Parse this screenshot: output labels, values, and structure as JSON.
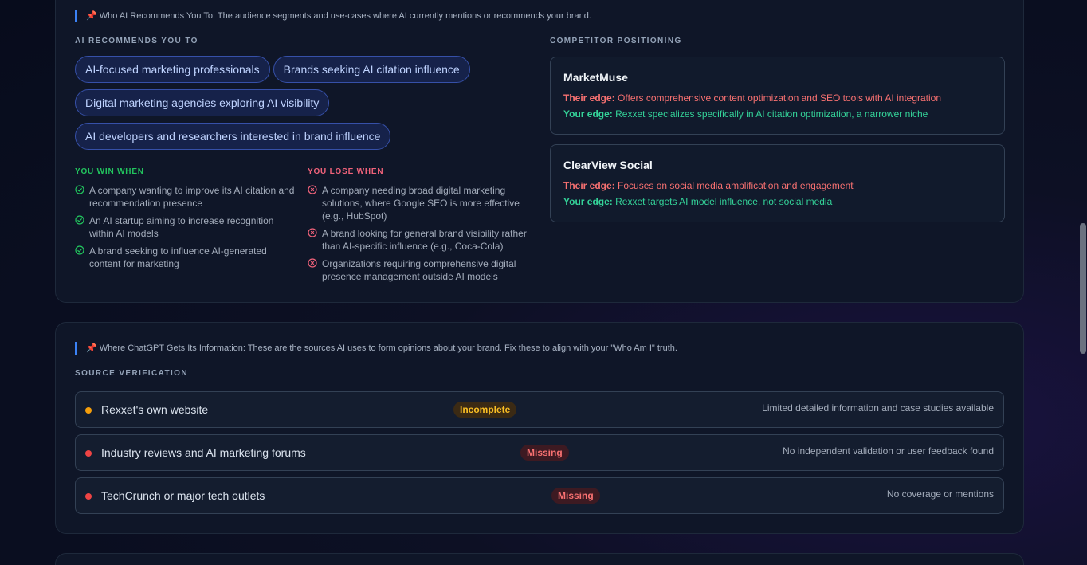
{
  "recommend_section": {
    "note": "📌 Who AI Recommends You To: The audience segments and use-cases where AI currently mentions or recommends your brand.",
    "title": "AI RECOMMENDS YOU TO",
    "chips": [
      "AI-focused marketing professionals",
      "Brands seeking AI citation influence",
      "Digital marketing agencies exploring AI visibility",
      "AI developers and researchers interested in brand influence"
    ],
    "win_title": "YOU WIN WHEN",
    "win_items": [
      "A company wanting to improve its AI citation and recommendation presence",
      "An AI startup aiming to increase recognition within AI models",
      "A brand seeking to influence AI-generated content for marketing"
    ],
    "lose_title": "YOU LOSE WHEN",
    "lose_items": [
      "A company needing broad digital marketing solutions, where Google SEO is more effective (e.g., HubSpot)",
      "A brand looking for general brand visibility rather than AI-specific influence (e.g., Coca-Cola)",
      "Organizations requiring comprehensive digital presence management outside AI models"
    ]
  },
  "competitor_section": {
    "title": "COMPETITOR POSITIONING",
    "their_label": "Their edge:",
    "your_label": "Your edge:",
    "competitors": [
      {
        "name": "MarketMuse",
        "their_edge": "Offers comprehensive content optimization and SEO tools with AI integration",
        "your_edge": "Rexxet specializes specifically in AI citation optimization, a narrower niche"
      },
      {
        "name": "ClearView Social",
        "their_edge": "Focuses on social media amplification and engagement",
        "your_edge": "Rexxet targets AI model influence, not social media"
      }
    ]
  },
  "source_section": {
    "note": "📌 Where ChatGPT Gets Its Information: These are the sources AI uses to form opinions about your brand. Fix these to align with your \"Who Am I\" truth.",
    "title": "SOURCE VERIFICATION",
    "sources": [
      {
        "name": "Rexxet's own website",
        "status": "Incomplete",
        "note": "Limited detailed information and case studies available"
      },
      {
        "name": "Industry reviews and AI marketing forums",
        "status": "Missing",
        "note": "No independent validation or user feedback found"
      },
      {
        "name": "TechCrunch or major tech outlets",
        "status": "Missing",
        "note": "No coverage or mentions"
      }
    ]
  },
  "colors": {
    "incomplete": "#f59e0b",
    "missing": "#ef4444",
    "win": "#22c55e",
    "lose": "#f0627a"
  },
  "icons": {
    "pin": "pushpin-icon",
    "win": "check-circle-icon",
    "lose": "x-circle-icon"
  }
}
